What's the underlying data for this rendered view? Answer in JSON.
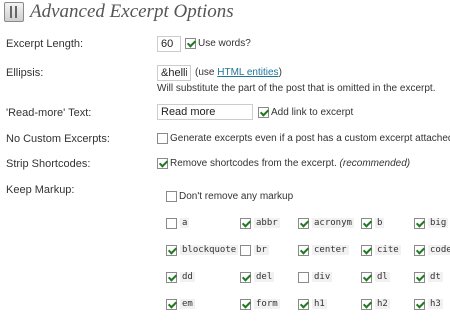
{
  "page": {
    "title": "Advanced Excerpt Options"
  },
  "excerpt_length": {
    "label": "Excerpt Length:",
    "value": "60",
    "use_words": {
      "label": "Use words?",
      "checked": true
    }
  },
  "ellipsis": {
    "label": "Ellipsis:",
    "value": "&hellip",
    "use_prefix": "(use ",
    "use_link": "HTML entities",
    "use_suffix": ")",
    "description": "Will substitute the part of the post that is omitted in the excerpt."
  },
  "read_more": {
    "label": "'Read-more' Text:",
    "value": "Read more",
    "add_link": {
      "label": "Add link to excerpt",
      "checked": true
    }
  },
  "no_custom": {
    "label": "No Custom Excerpts:",
    "option": {
      "label": "Generate excerpts even if a post has a custom excerpt attached.",
      "checked": false
    }
  },
  "strip_shortcodes": {
    "label": "Strip Shortcodes:",
    "option": {
      "label": "Remove shortcodes from the excerpt.",
      "note": "(recommended)",
      "checked": true
    }
  },
  "keep_markup": {
    "label": "Keep Markup:",
    "dont_remove": {
      "label": "Don't remove any markup",
      "checked": false
    },
    "tags": [
      {
        "name": "a",
        "checked": false
      },
      {
        "name": "abbr",
        "checked": true
      },
      {
        "name": "acronym",
        "checked": true
      },
      {
        "name": "b",
        "checked": true
      },
      {
        "name": "big",
        "checked": true
      },
      {
        "name": "blockquote",
        "checked": true
      },
      {
        "name": "br",
        "checked": false
      },
      {
        "name": "center",
        "checked": true
      },
      {
        "name": "cite",
        "checked": true
      },
      {
        "name": "code",
        "checked": true
      },
      {
        "name": "dd",
        "checked": true
      },
      {
        "name": "del",
        "checked": true
      },
      {
        "name": "div",
        "checked": false
      },
      {
        "name": "dl",
        "checked": true
      },
      {
        "name": "dt",
        "checked": true
      },
      {
        "name": "em",
        "checked": true
      },
      {
        "name": "form",
        "checked": true
      },
      {
        "name": "h1",
        "checked": true
      },
      {
        "name": "h2",
        "checked": true
      },
      {
        "name": "h3",
        "checked": true
      }
    ]
  }
}
